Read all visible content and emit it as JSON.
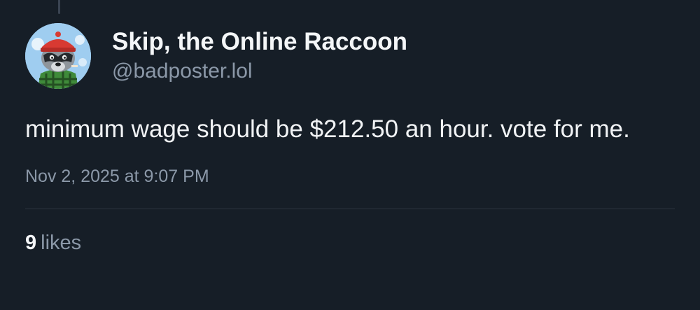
{
  "post": {
    "author": {
      "display_name": "Skip, the Online Raccoon",
      "handle": "@badposter.lol",
      "avatar_icon": "raccoon-avatar-icon"
    },
    "text": "minimum wage should be $212.50 an hour. vote for me.",
    "timestamp": "Nov 2, 2025 at 9:07 PM",
    "likes": {
      "count": "9",
      "label": "likes"
    }
  },
  "theme": {
    "background": "#161e27",
    "text_primary": "#f1f3f5",
    "text_secondary": "#8b98a8",
    "divider": "#2c3540"
  }
}
